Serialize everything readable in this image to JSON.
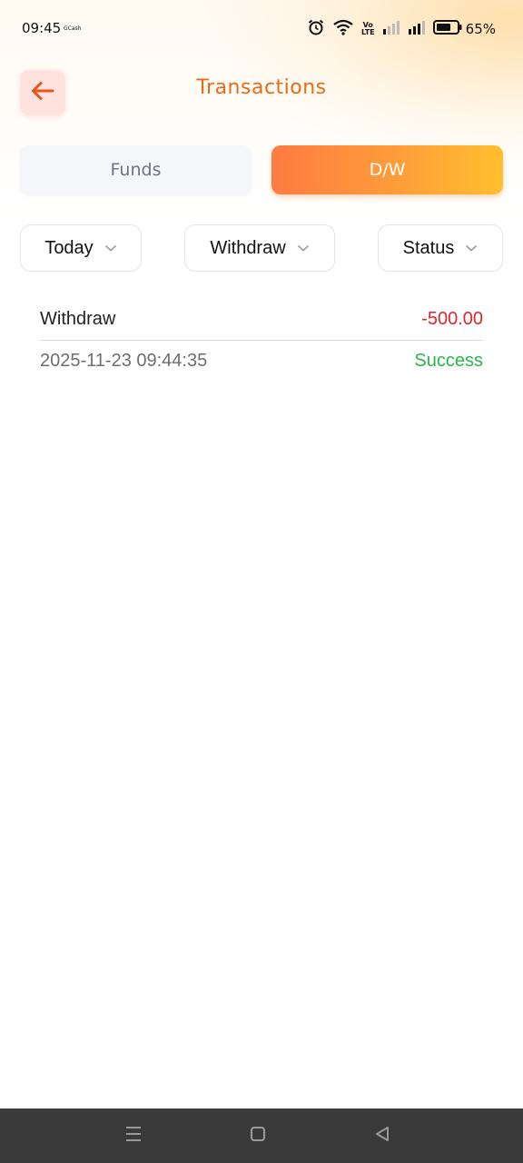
{
  "status_bar": {
    "time": "09:45",
    "notification_app": "GCash",
    "volte_top": "Vo",
    "volte_bottom": "LTE",
    "battery_percent": "65%"
  },
  "header": {
    "title": "Transactions",
    "back_icon": "arrow-left-icon"
  },
  "tabs": [
    {
      "label": "Funds",
      "active": false
    },
    {
      "label": "D/W",
      "active": true
    }
  ],
  "filters": {
    "date": "Today",
    "type": "Withdraw",
    "status": "Status"
  },
  "transactions": [
    {
      "type": "Withdraw",
      "amount": "-500.00",
      "datetime": "2025-11-23 09:44:35",
      "status": "Success"
    }
  ],
  "colors": {
    "accent": "#ea6a1a",
    "tab_gradient_start": "#ff7b42",
    "tab_gradient_end": "#ffbf30",
    "amount_negative": "#e0262b",
    "status_success": "#27b84a",
    "back_button_bg": "#ffe2de",
    "nav_bar_bg": "#3a3a3a"
  },
  "nav_bar": {
    "icons": [
      "menu-icon",
      "home-icon",
      "back-icon"
    ]
  }
}
